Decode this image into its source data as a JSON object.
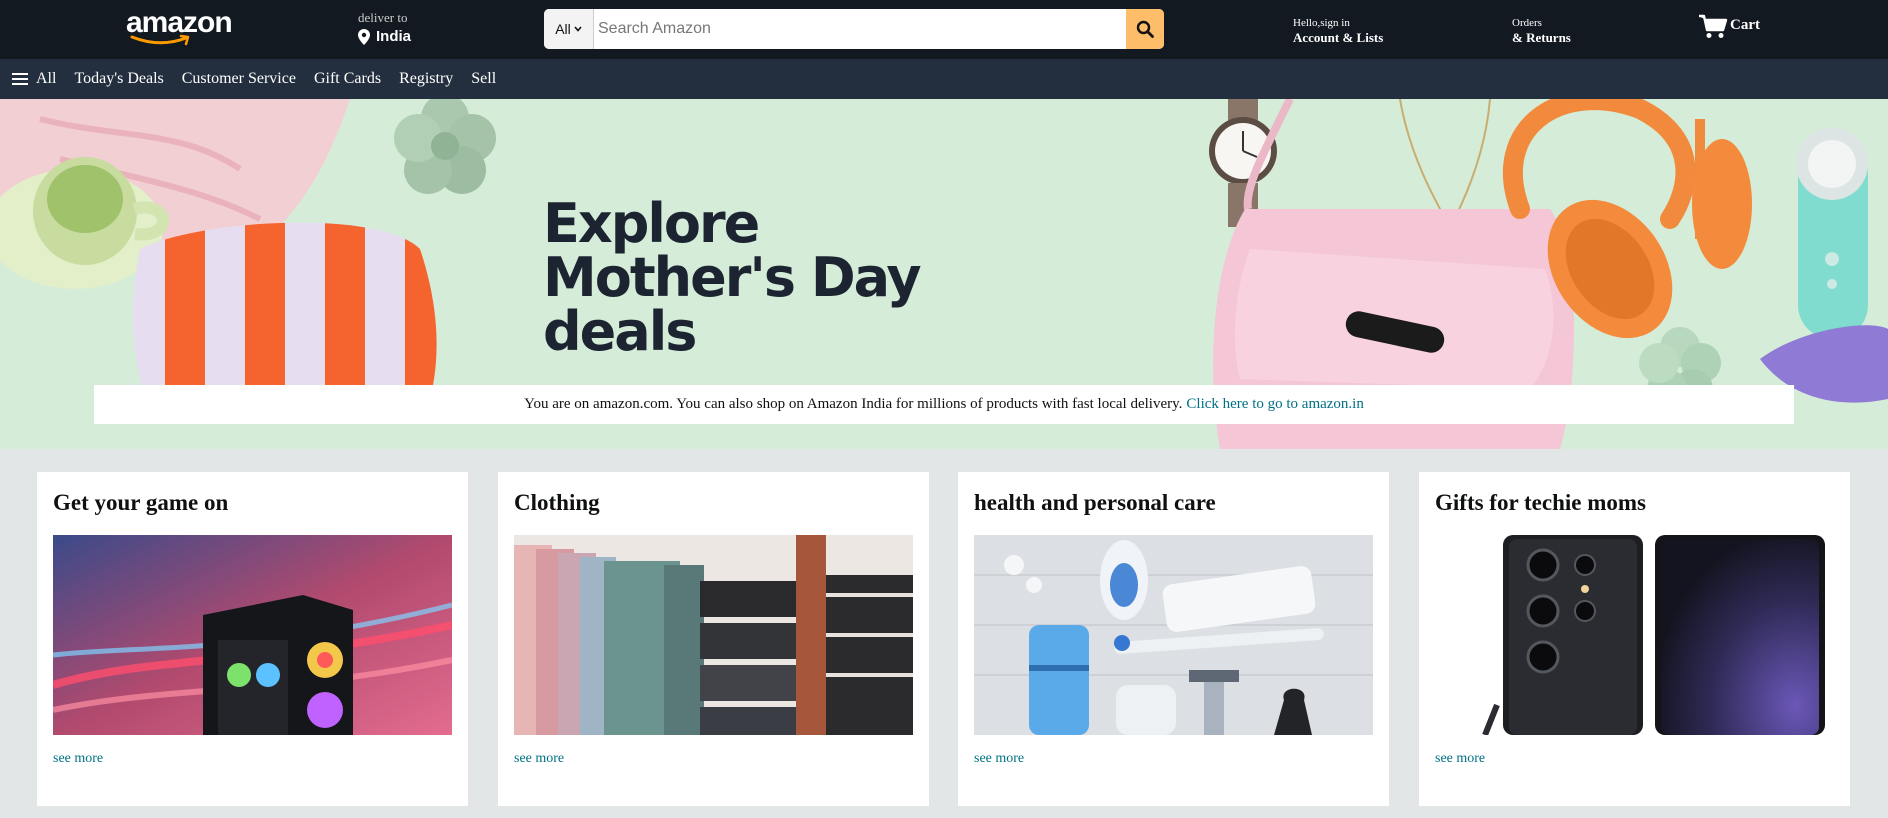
{
  "header": {
    "logo_text": "amazon",
    "deliver_to_label": "deliver to",
    "deliver_to_location": "India",
    "search": {
      "category": "All",
      "placeholder": "Search Amazon"
    },
    "account": {
      "greeting": "Hello,sign in",
      "label": "Account & Lists"
    },
    "orders": {
      "line1": "Orders",
      "line2": "& Returns"
    },
    "cart_label": "Cart"
  },
  "nav": {
    "all_label": "All",
    "items": [
      "Today's Deals",
      "Customer Service",
      "Gift Cards",
      "Registry",
      "Sell"
    ]
  },
  "hero": {
    "title": "Explore Mother's Day deals",
    "notice_text": "You are on amazon.com. You can also shop on Amazon India for millions of products with fast local delivery.",
    "notice_link": "Click here to go to amazon.in"
  },
  "cards": [
    {
      "title": "Get your game on",
      "link": "see more"
    },
    {
      "title": "Clothing",
      "link": "see more"
    },
    {
      "title": "health and personal care",
      "link": "see more"
    },
    {
      "title": "Gifts for techie moms",
      "link": "see more"
    }
  ],
  "colors": {
    "header_bg": "#131921",
    "nav_bg": "#232f3e",
    "search_button": "#febd69",
    "link": "#007185",
    "hero_bg": "#d5ecd8",
    "page_bg": "#e3e6e6"
  },
  "icons": [
    "location-pin-icon",
    "search-icon",
    "cart-icon",
    "hamburger-menu-icon",
    "chevron-down-icon"
  ]
}
